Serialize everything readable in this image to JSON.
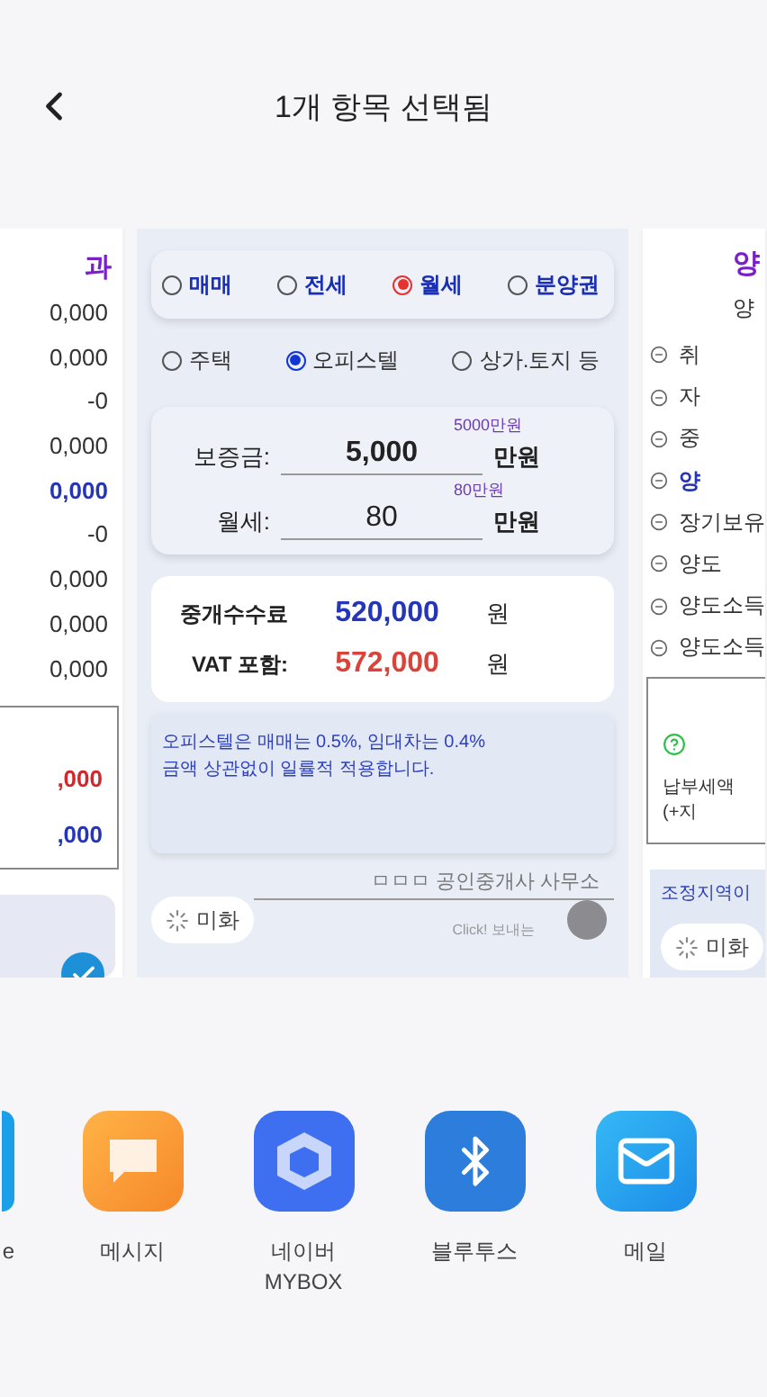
{
  "header": {
    "title": "1개 항목 선택됨"
  },
  "left_preview": {
    "title": "과",
    "values": [
      {
        "text": "0,000",
        "kind": "plain"
      },
      {
        "text": "0,000",
        "kind": "plain"
      },
      {
        "text": "-0",
        "kind": "plain"
      },
      {
        "text": "0,000",
        "kind": "plain"
      },
      {
        "text": "0,000",
        "kind": "blue"
      },
      {
        "text": "-0",
        "kind": "plain"
      },
      {
        "text": "0,000",
        "kind": "plain"
      },
      {
        "text": "0,000",
        "kind": "plain"
      },
      {
        "text": "0,000",
        "kind": "plain"
      }
    ],
    "box_values": [
      {
        "text": ",000",
        "kind": "red"
      },
      {
        "text": ",000",
        "kind": "blue"
      }
    ],
    "checked": true
  },
  "main_card": {
    "deal_types": [
      {
        "label": "매매",
        "selected": false
      },
      {
        "label": "전세",
        "selected": false
      },
      {
        "label": "월세",
        "selected": true
      },
      {
        "label": "분양권",
        "selected": false
      }
    ],
    "property_types": [
      {
        "label": "주택",
        "selected": false
      },
      {
        "label": "오피스텔",
        "selected": true
      },
      {
        "label": "상가.토지 등",
        "selected": false
      }
    ],
    "inputs": [
      {
        "label": "보증금:",
        "value": "5,000",
        "hint": "5000만원",
        "unit": "만원",
        "bold": true
      },
      {
        "label": "월세:",
        "value": "80",
        "hint": "80만원",
        "unit": "만원",
        "bold": false
      }
    ],
    "results": [
      {
        "label": "중개수수료",
        "value": "520,000",
        "unit": "원",
        "kind": "fee"
      },
      {
        "label": "VAT 포함:",
        "value": "572,000",
        "unit": "원",
        "kind": "vat"
      }
    ],
    "note": [
      "오피스텔은 매매는 0.5%, 임대차는 0.4%",
      "금액 상관없이 일률적 적용합니다."
    ],
    "beautify_button": "미화",
    "office": "ㅁㅁㅁ 공인중개사 사무소",
    "send_hint": "Click! 보내는"
  },
  "right_preview": {
    "title": "양",
    "subtitle": "양",
    "rows": [
      {
        "text": "취",
        "kind": "plain"
      },
      {
        "text": "자",
        "kind": "plain"
      },
      {
        "text": "중",
        "kind": "plain"
      },
      {
        "text": "양",
        "kind": "blue"
      },
      {
        "text": "장기보유",
        "kind": "plain"
      },
      {
        "text": "양도",
        "kind": "plain"
      },
      {
        "text": "양도소득",
        "kind": "plain"
      },
      {
        "text": "양도소득",
        "kind": "plain"
      }
    ],
    "box_text": "납부세액(+지",
    "note": "조정지역이",
    "beautify_button": "미화"
  },
  "share_apps": [
    {
      "label": "e",
      "kind": "partial"
    },
    {
      "label": "메시지",
      "kind": "message"
    },
    {
      "label": "네이버\nMYBOX",
      "kind": "cube"
    },
    {
      "label": "블루투스",
      "kind": "bluetooth"
    },
    {
      "label": "메일",
      "kind": "mail"
    }
  ]
}
